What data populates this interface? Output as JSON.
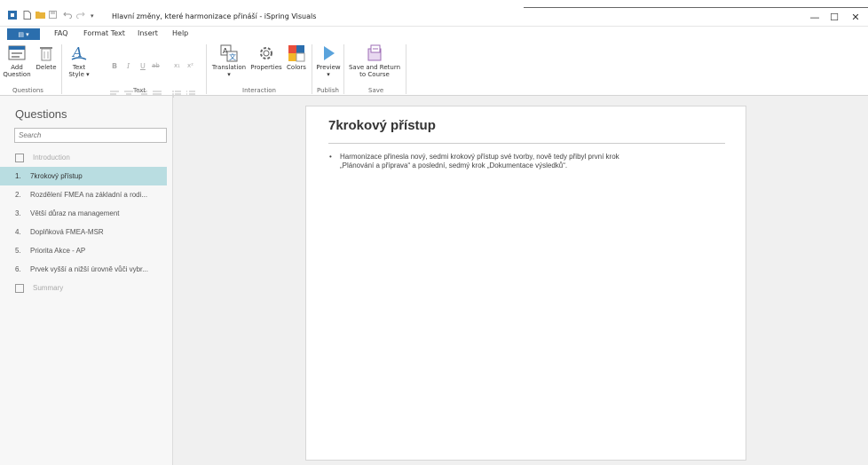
{
  "window": {
    "title": "Hlavní změny, které harmonizace přináší - iSpring Visuals",
    "minimize": "—",
    "maximize": "☐",
    "close": "✕"
  },
  "menu": {
    "app_label": "▤ ▾",
    "items": [
      "FAQ",
      "Format Text",
      "Insert",
      "Help"
    ]
  },
  "ribbon": {
    "add_question": [
      "Add",
      "Question"
    ],
    "delete": "Delete",
    "text_style": [
      "Text",
      "Style ▾"
    ],
    "format_buttons": [
      "B",
      "I",
      "U",
      "ab",
      "x₁",
      "x²"
    ],
    "translation": "Translation",
    "properties": "Properties",
    "colors": "Colors",
    "preview": "Preview",
    "save_return": [
      "Save and Return",
      "to Course"
    ],
    "groups": [
      "Questions",
      "Text",
      "Interaction",
      "Publish",
      "Save"
    ]
  },
  "sidebar": {
    "title": "Questions",
    "search_placeholder": "Search",
    "intro": "Introduction",
    "items": [
      {
        "num": "1.",
        "label": "7krokový přístup"
      },
      {
        "num": "2.",
        "label": "Rozdělení FMEA na základní a rodi..."
      },
      {
        "num": "3.",
        "label": "Větší důraz na management"
      },
      {
        "num": "4.",
        "label": "Doplňková FMEA-MSR"
      },
      {
        "num": "5.",
        "label": "Priorita Akce - AP"
      },
      {
        "num": "6.",
        "label": "Prvek vyšší a nižší úrovně vůči vybr..."
      }
    ],
    "summary": "Summary",
    "selected_index": 0
  },
  "slide": {
    "title": "7krokový přístup",
    "bullet_line1": "Harmonizace přinesla nový, sedmi krokový přístup své tvorby, nově tedy přibyl první krok",
    "bullet_line2": "„Plánování a příprava“ a poslední, sedmý krok „Dokumentace výsledků“."
  },
  "colors": {
    "accent": "#2b6ead",
    "selection": "#b9dde1"
  }
}
